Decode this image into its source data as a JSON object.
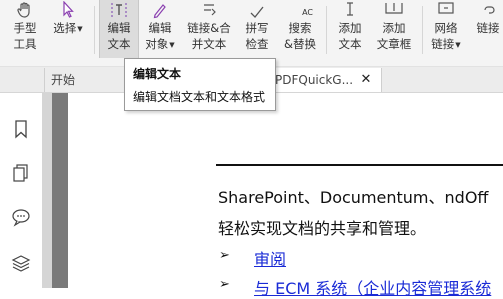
{
  "ribbon": {
    "buttons": [
      {
        "id": "hand",
        "line1": "手型",
        "line2": "工具",
        "icon": "hand-icon"
      },
      {
        "id": "select",
        "line1": "选择",
        "line2": "",
        "icon": "cursor-icon"
      },
      {
        "id": "edit-text",
        "line1": "编辑",
        "line2": "文本",
        "icon": "edit-text-icon"
      },
      {
        "id": "edit-object",
        "line1": "编辑",
        "line2": "对象",
        "icon": "edit-object-icon"
      },
      {
        "id": "link-merge",
        "line1": "链接&合",
        "line2": "并文本",
        "icon": "link-merge-icon"
      },
      {
        "id": "spell",
        "line1": "拼写",
        "line2": "检查",
        "icon": "spellcheck-icon"
      },
      {
        "id": "search-replace",
        "line1": "搜索",
        "line2": "&替换",
        "icon": "search-replace-icon"
      },
      {
        "id": "add-text",
        "line1": "添加",
        "line2": "文本",
        "icon": "add-text-icon"
      },
      {
        "id": "add-textbox",
        "line1": "添加",
        "line2": "文章框",
        "icon": "add-textbox-icon"
      },
      {
        "id": "web-link",
        "line1": "网络",
        "line2": "链接",
        "icon": "web-link-icon"
      },
      {
        "id": "link",
        "line1": "链接",
        "line2": "",
        "icon": "link-icon"
      }
    ],
    "spell_icon_text": "ABC",
    "search_icon_text": "AC"
  },
  "tabs": {
    "start": "开始",
    "doc": "PDFQuickG...",
    "close": "✕"
  },
  "tooltip": {
    "title": "编辑文本",
    "description": "编辑文档文本和文本格式"
  },
  "document": {
    "line1": "SharePoint、Documentum、ndOff",
    "line2": "轻松实现文档的共享和管理。",
    "bullet_glyph": "➢",
    "link1": "审阅",
    "link2": "与 ECM 系统（企业内容管理系统"
  }
}
